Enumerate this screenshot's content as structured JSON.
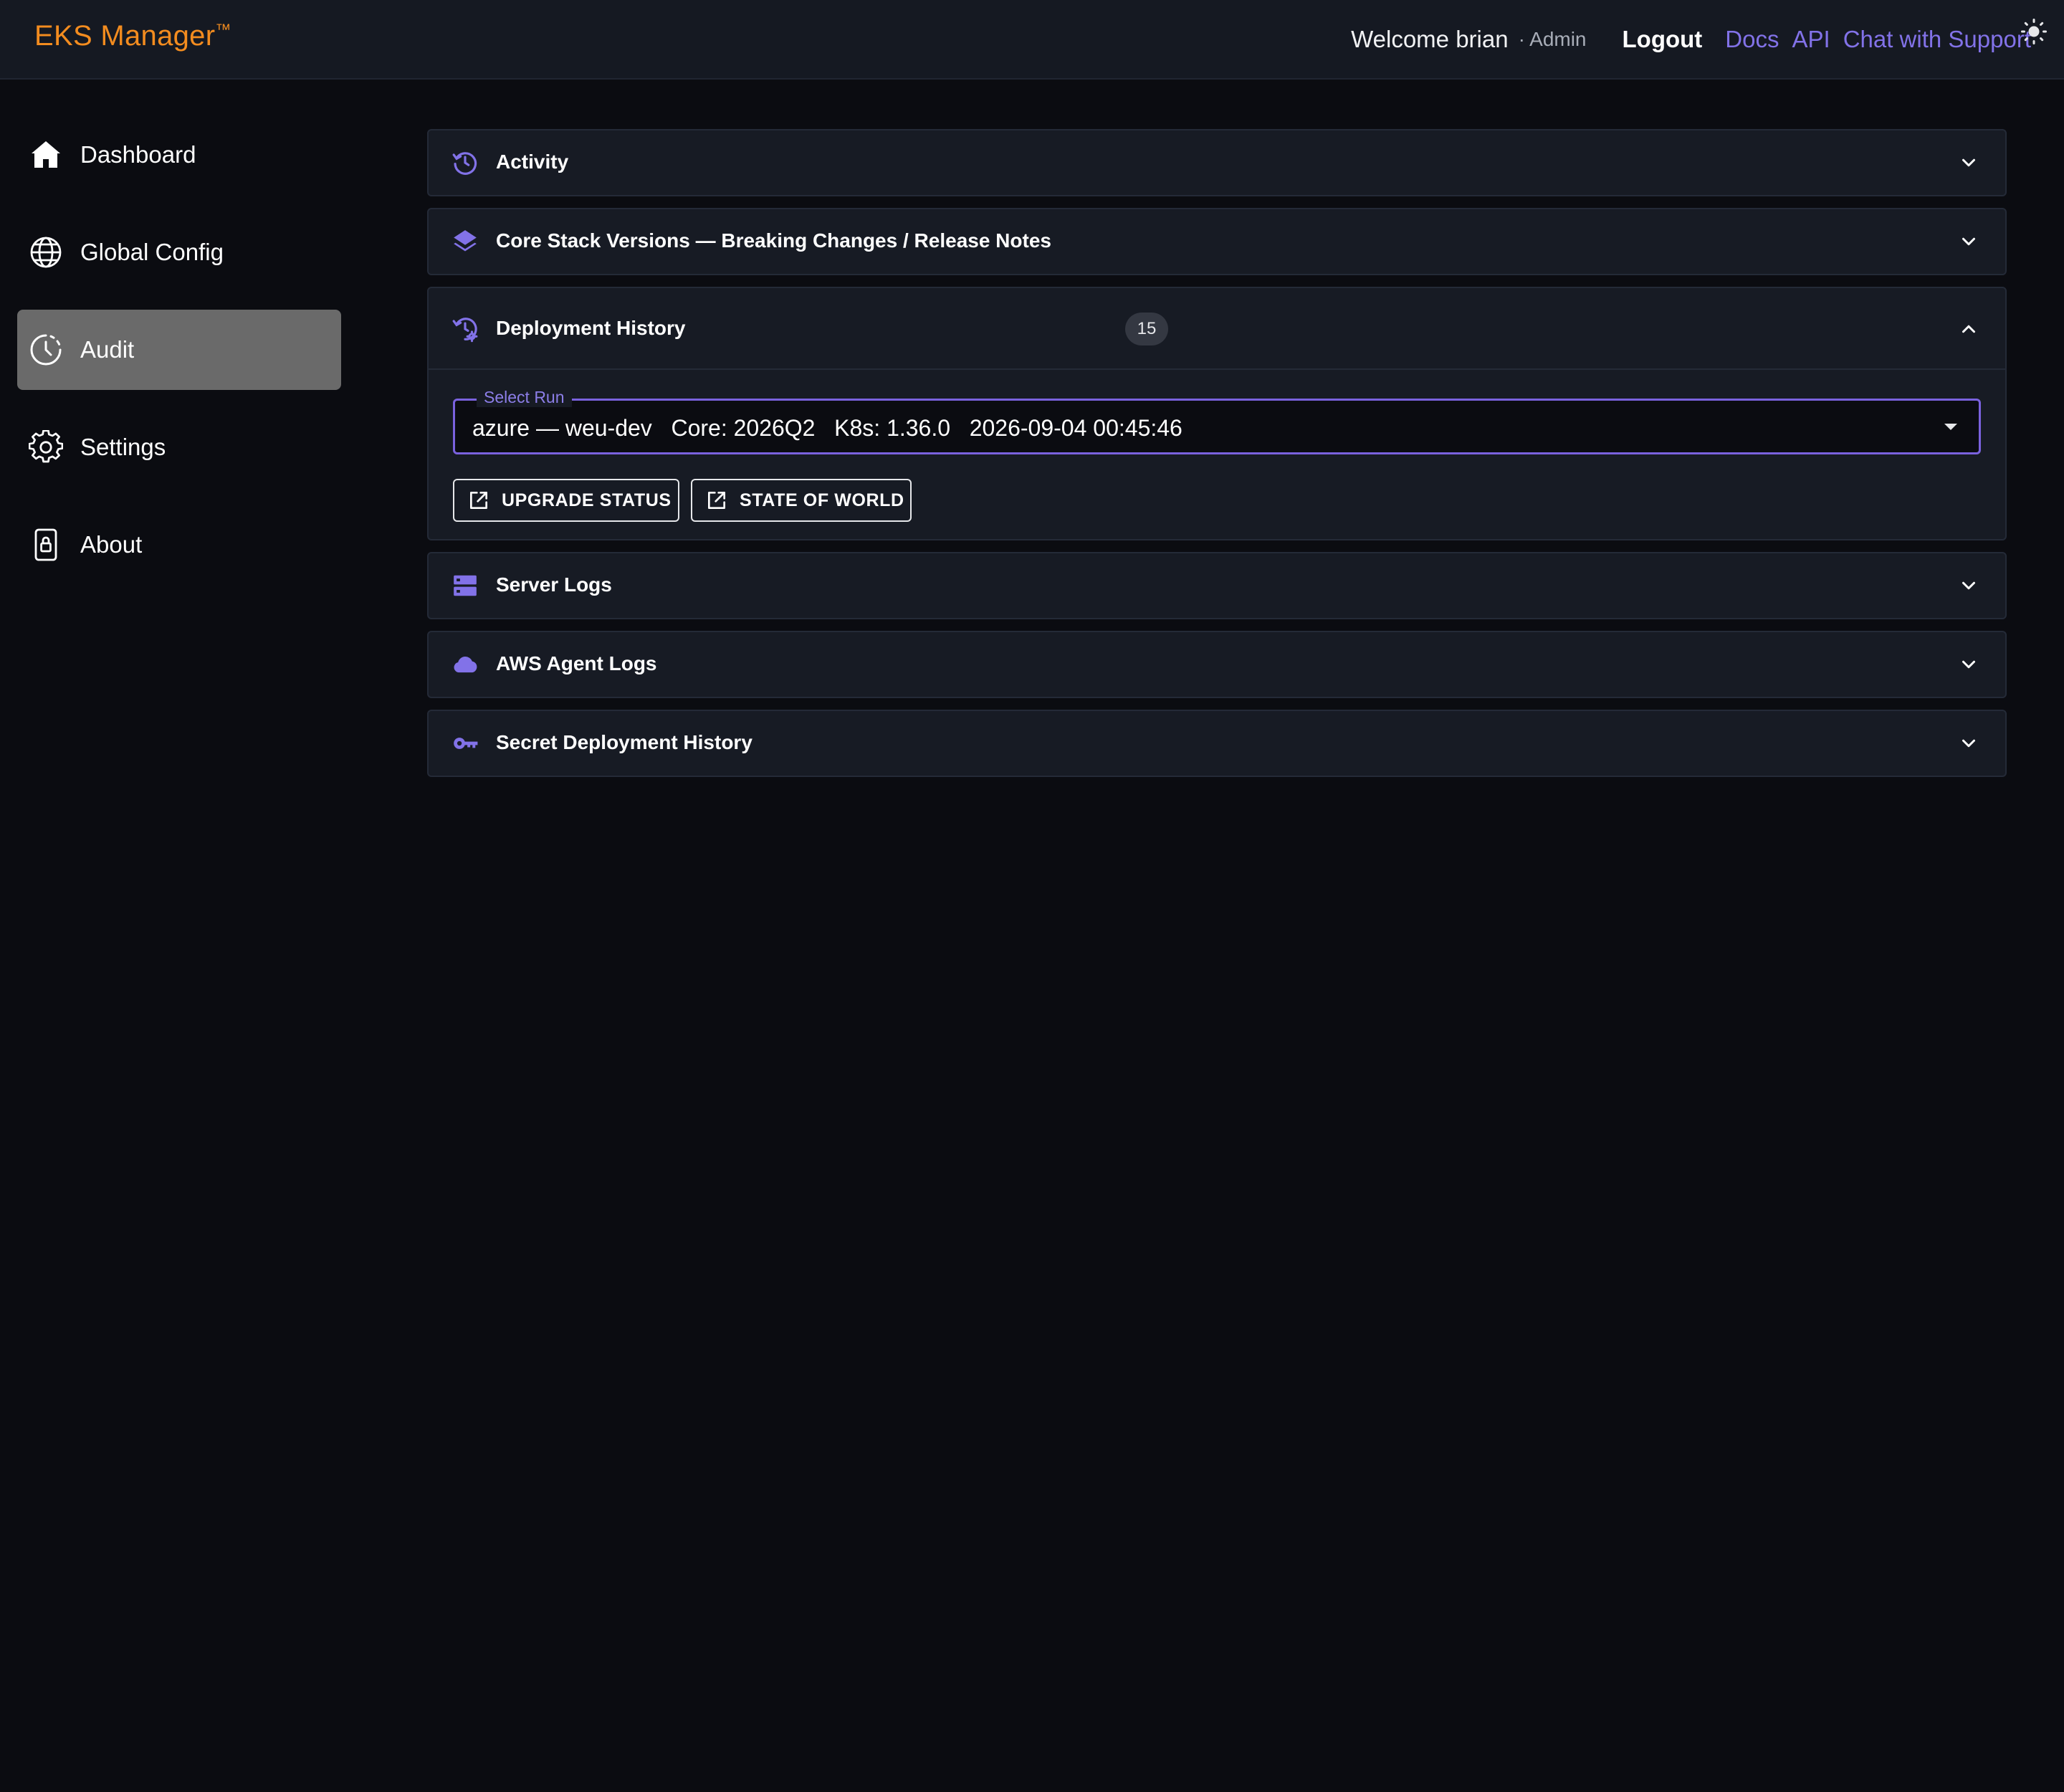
{
  "header": {
    "brand": "EKS Manager",
    "brand_tm": "™",
    "welcome": "Welcome brian",
    "role": "· Admin",
    "logout": "Logout",
    "links": {
      "docs": "Docs",
      "api": "API",
      "chat": "Chat with Support"
    },
    "theme_icon": "sun-icon"
  },
  "sidebar": {
    "items": [
      {
        "label": "Dashboard",
        "icon": "home-icon"
      },
      {
        "label": "Global Config",
        "icon": "globe-icon"
      },
      {
        "label": "Audit",
        "icon": "clock-icon",
        "active": true
      },
      {
        "label": "Settings",
        "icon": "gear-icon"
      },
      {
        "label": "About",
        "icon": "lock-icon"
      }
    ]
  },
  "main": {
    "panels": [
      {
        "title": "Activity",
        "icon": "history-icon",
        "expanded": false
      },
      {
        "title": "Core Stack Versions — Breaking Changes / Release Notes",
        "icon": "layers-icon",
        "expanded": false
      },
      {
        "title": "Deployment History",
        "icon": "history-gear-icon",
        "expanded": true,
        "badge": "15",
        "select": {
          "label": "Select Run",
          "value": "azure — weu-dev   Core: 2026Q2   K8s: 1.36.0   2026-09-04 00:45:46"
        },
        "buttons": {
          "upgrade": "UPGRADE STATUS",
          "world": "STATE OF WORLD"
        }
      },
      {
        "title": "Server Logs",
        "icon": "server-icon",
        "expanded": false
      },
      {
        "title": "AWS Agent Logs",
        "icon": "cloud-icon",
        "expanded": false
      },
      {
        "title": "Secret Deployment History",
        "icon": "key-icon",
        "expanded": false
      }
    ]
  },
  "colors": {
    "brand": "#f38c1f",
    "accent": "#8272e8",
    "active_nav": "#6a6a6a",
    "background": "#0b0c11",
    "panel": "#171b24"
  }
}
